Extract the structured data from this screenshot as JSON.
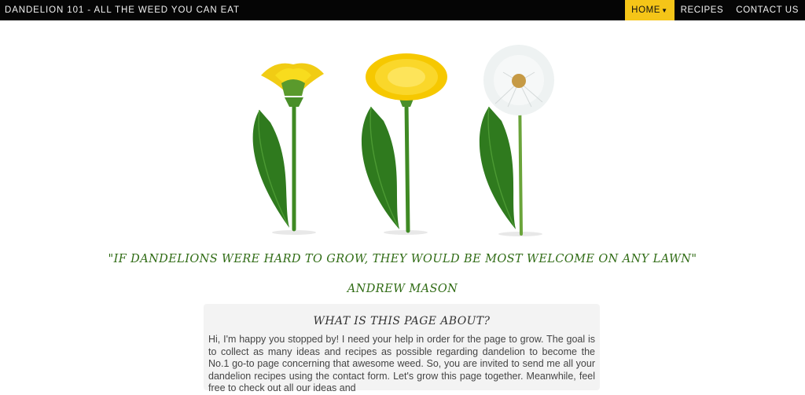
{
  "navbar": {
    "brand": "DANDELION 101 - ALL THE WEED YOU CAN EAT",
    "items": [
      {
        "label": "HOME",
        "active": true,
        "dropdown": true
      },
      {
        "label": "RECIPES",
        "active": false
      },
      {
        "label": "CONTACT US",
        "active": false
      }
    ]
  },
  "hero": {
    "quote": "\"IF DANDELIONS WERE HARD TO GROW, THEY WOULD BE MOST WELCOME ON ANY LAWN\"",
    "author": "ANDREW MASON"
  },
  "about": {
    "title": "WHAT IS THIS PAGE ABOUT?",
    "text": "Hi, I'm happy you stopped by! I need your help in order for the page to grow. The goal is to collect as many ideas and recipes as possible regarding dandelion to become the No.1 go-to page concerning that awesome weed. So, you are invited to send me all your dandelion recipes using the contact form. Let's grow this page together. Meanwhile, feel free to check out all our ideas and"
  },
  "colors": {
    "navbar_bg": "#050505",
    "active_nav": "#f5c518",
    "quote_green": "#2f6b14",
    "panel_bg": "#f3f3f3"
  }
}
